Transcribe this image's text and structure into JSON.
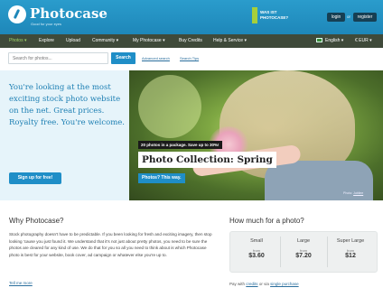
{
  "header": {
    "brand": "Photocase",
    "tagline": "Good for your eyes",
    "promo_line1": "WAS IST",
    "promo_line2": "PHOTOCASE?",
    "login_label": "login",
    "or_text": "or",
    "register_label": "register"
  },
  "nav": {
    "items": [
      "Photos",
      "Explore",
      "Upload",
      "Community",
      "My Photocase",
      "Buy Credits",
      "Help & Service"
    ],
    "language": "English",
    "currency": "EUR"
  },
  "search": {
    "placeholder": "Search for photos...",
    "button_label": "Search",
    "advanced_label": "Advanced search",
    "tips_label": "Search Tips"
  },
  "hero": {
    "headline": "You're looking at the most exciting stock photo website on the net. Great prices. Royalty free. You're welcome.",
    "signup_label": "Sign up for free!",
    "caption_small": "20 photos in a package. Save up to 30%!",
    "caption_title": "Photo Collection: Spring",
    "caption_button": "Photos? This way.",
    "credit_label": "Photo:",
    "credit_author": "Jubilee"
  },
  "why": {
    "title": "Why Photocase?",
    "body": "Stock photography doesn't have to be predictable. If you been looking for fresh and exciting imagery, then stop looking 'cause you just found it. We understand that it's not just about pretty photos, you need to be sure the photos are cleared for any kind of use. We do that for you so all you need to think about is which Photocase photo is best for your website, book cover, ad campaign or whatever else you're up to.",
    "more_label": "Tell me more"
  },
  "pricing": {
    "title": "How much for a photo?",
    "tiers": [
      {
        "name": "Small",
        "from": "from",
        "price": "$3.60"
      },
      {
        "name": "Large",
        "from": "from",
        "price": "$7.20"
      },
      {
        "name": "Super Large",
        "from": "from",
        "price": "$12"
      }
    ],
    "note_prefix": "Pay with",
    "note_credits": "credits",
    "note_or": "or via",
    "note_single": "single purchase"
  },
  "colors": {
    "header_blue": "#1e87b9",
    "nav_bg": "#3f4a3a",
    "accent_green": "#9fd46a",
    "button_blue": "#1f8ec7",
    "hero_panel": "#e6f4fa"
  }
}
